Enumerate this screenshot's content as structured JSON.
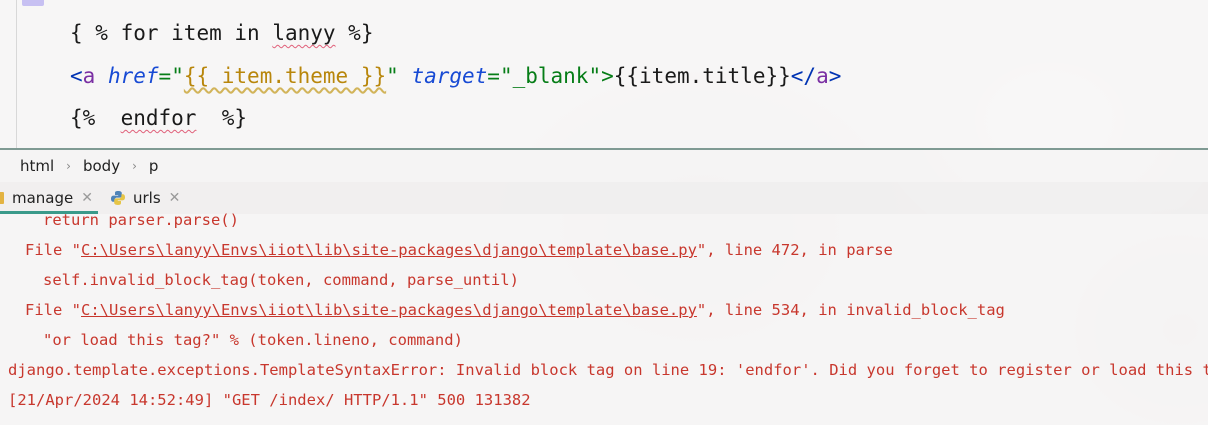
{
  "editor": {
    "lines": [
      {
        "pre": "{ % ",
        "kw": "for",
        "mid": " item in ",
        "var": "lanyy",
        "post": " %}"
      },
      {
        "lt": "<",
        "tag": "a",
        "sp1": " ",
        "attr1": "href",
        "eq1": "=\"",
        "tmpl": "{{ item.theme }}",
        "q1": "\" ",
        "attr2": "target",
        "eq2": "=\"",
        "val2": "_blank",
        "q2": "\">",
        "content": "{{item.title}}",
        "close_lt": "</",
        "close_tag": "a",
        "close_gt": ">"
      },
      {
        "pre": "{%  ",
        "kw": "endfor",
        "post": "  %}"
      }
    ]
  },
  "breadcrumb": [
    "html",
    "body",
    "p"
  ],
  "run_tabs": [
    {
      "label": "manage",
      "active": true
    },
    {
      "label": "urls",
      "active": false
    }
  ],
  "console": {
    "lines": [
      {
        "text": "return parser.parse()"
      },
      {
        "pre": "File \"",
        "link": "C:\\Users\\lanyy\\Envs\\iiot\\lib\\site-packages\\django\\template\\base.py",
        "post": "\", line 472, in parse"
      },
      {
        "text": "self.invalid_block_tag(token, command, parse_until)"
      },
      {
        "pre": "File \"",
        "link": "C:\\Users\\lanyy\\Envs\\iiot\\lib\\site-packages\\django\\template\\base.py",
        "post": "\", line 534, in invalid_block_tag"
      },
      {
        "text": "\"or load this tag?\" % (token.lineno, command)"
      },
      {
        "text": "django.template.exceptions.TemplateSyntaxError: Invalid block tag on line 19: 'endfor'. Did you forget to register or load this tag?"
      },
      {
        "text": "[21/Apr/2024 14:52:49] \"GET /index/ HTTP/1.1\" 500 131382"
      }
    ]
  },
  "colors": {
    "error": "#c8372d",
    "active_tab": "#3a9a8a",
    "tag": "#0033b3",
    "string": "#067d17"
  }
}
